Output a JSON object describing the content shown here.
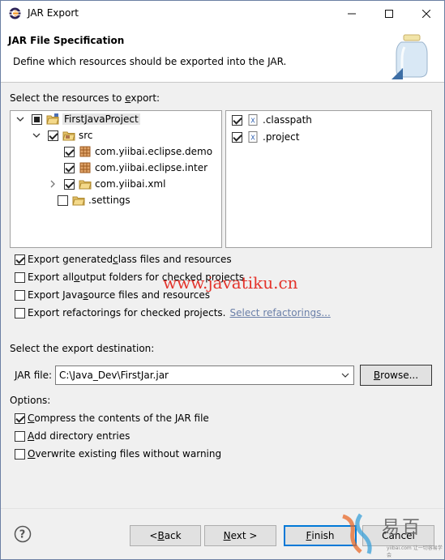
{
  "window": {
    "title": "JAR Export",
    "controls": {
      "minimize": "—",
      "maximize": "☐",
      "close": "✕"
    }
  },
  "header": {
    "title": "JAR File Specification",
    "description": "Define which resources should be exported into the JAR."
  },
  "resources": {
    "label_pre": "Select the resources to ",
    "label_u": "e",
    "label_post": "xport:",
    "tree": [
      {
        "label": "FirstJavaProject",
        "state": "partial",
        "expanded": true,
        "icon": "project-folder-icon"
      },
      {
        "label": "src",
        "state": "checked",
        "expanded": true,
        "icon": "source-folder-icon"
      },
      {
        "label": "com.yiibai.eclipse.demo",
        "state": "checked",
        "icon": "package-icon"
      },
      {
        "label": "com.yiibai.eclipse.inter",
        "state": "checked",
        "icon": "package-icon"
      },
      {
        "label": "com.yiibai.xml",
        "state": "checked",
        "expanded": false,
        "icon": "folder-icon"
      },
      {
        "label": ".settings",
        "state": "unchecked",
        "icon": "folder-icon"
      }
    ],
    "files": [
      {
        "label": ".classpath",
        "state": "checked",
        "icon": "xml-file-icon"
      },
      {
        "label": ".project",
        "state": "checked",
        "icon": "xml-file-icon"
      }
    ]
  },
  "options_export": [
    {
      "pre": "Export generated ",
      "u": "c",
      "post": "lass files and resources",
      "checked": true
    },
    {
      "pre": "Export all ",
      "u": "o",
      "post": "utput folders for checked projects",
      "checked": false
    },
    {
      "pre": "Export Java ",
      "u": "s",
      "post": "ource files and resources",
      "checked": false
    },
    {
      "pre": "Export refactorings for checked projects.",
      "u": "",
      "post": "",
      "checked": false
    }
  ],
  "select_refactorings_link": "Select refactorings...",
  "destination": {
    "label": "Select the export destination:",
    "jar_label_u": "J",
    "jar_label_rest": "AR file:",
    "jar_value": "C:\\Java_Dev\\FirstJar.jar",
    "browse_u": "B",
    "browse_rest": "rowse..."
  },
  "options": {
    "label": "Options:",
    "items": [
      {
        "pre": "",
        "u": "C",
        "post": "ompress the contents of the JAR file",
        "checked": true
      },
      {
        "pre": "",
        "u": "A",
        "post": "dd directory entries",
        "checked": false
      },
      {
        "pre": "",
        "u": "O",
        "post": "verwrite existing files without warning",
        "checked": false
      }
    ]
  },
  "buttons": {
    "back_pre": "< ",
    "back_u": "B",
    "back_post": "ack",
    "next_u": "N",
    "next_post": "ext >",
    "finish_u": "F",
    "finish_post": "inish",
    "cancel": "Cancel"
  },
  "watermark": {
    "site": "www.javatiku.cn",
    "brand_cn": "易百",
    "brand_en": "yiibai.com",
    "brand_sub": "让一切容易学会"
  },
  "colors": {
    "accent": "#0078d7",
    "watermark_red": "#e3241b",
    "link": "#6a7fa8"
  }
}
